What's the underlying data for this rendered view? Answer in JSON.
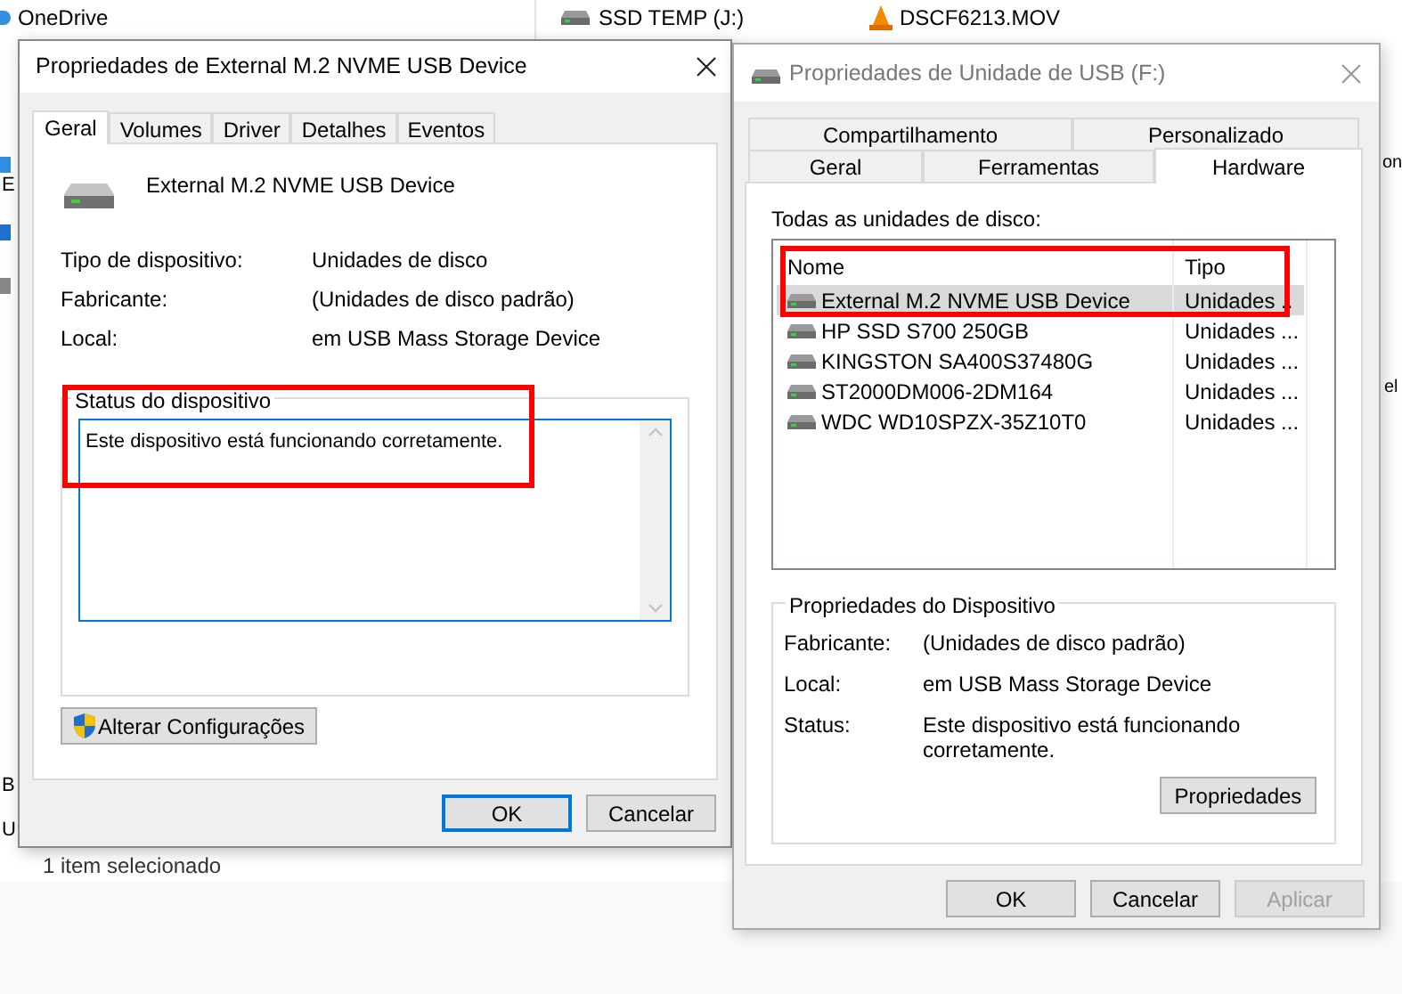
{
  "background": {
    "nav_items": [
      "OneDrive"
    ],
    "drive": "SSD TEMP (J:)",
    "file": "DSCF6213.MOV",
    "status_bar": "1 item selecionado",
    "left_fragments": [
      "E",
      "B",
      "U"
    ],
    "right_fragments": [
      "on",
      "el"
    ]
  },
  "device_dialog": {
    "title": "Propriedades de External M.2 NVME USB Device",
    "tabs": [
      {
        "label": "Geral",
        "selected": true
      },
      {
        "label": "Volumes",
        "selected": false
      },
      {
        "label": "Driver",
        "selected": false
      },
      {
        "label": "Detalhes",
        "selected": false
      },
      {
        "label": "Eventos",
        "selected": false
      }
    ],
    "device_name": "External M.2 NVME USB Device",
    "properties": [
      {
        "label": "Tipo de dispositivo:",
        "value": "Unidades de disco"
      },
      {
        "label": "Fabricante:",
        "value": "(Unidades de disco padrão)"
      },
      {
        "label": "Local:",
        "value": "em USB Mass Storage Device"
      }
    ],
    "status_group": {
      "title": "Status do dispositivo",
      "text": "Este dispositivo está funcionando corretamente."
    },
    "change_button": "Alterar Configurações",
    "buttons": [
      {
        "label": "OK",
        "default": true
      },
      {
        "label": "Cancelar",
        "default": false
      }
    ]
  },
  "drive_dialog": {
    "title": "Propriedades de Unidade de USB (F:)",
    "tab_rows": [
      [
        {
          "label": "Compartilhamento",
          "selected": false
        },
        {
          "label": "Personalizado",
          "selected": false
        }
      ],
      [
        {
          "label": "Geral",
          "selected": false
        },
        {
          "label": "Ferramentas",
          "selected": false
        },
        {
          "label": "Hardware",
          "selected": true
        }
      ]
    ],
    "list_label": "Todas as unidades de disco:",
    "columns": [
      "Nome",
      "Tipo"
    ],
    "disks": [
      {
        "name": "External M.2 NVME USB Device",
        "type": "Unidades ..",
        "selected": true
      },
      {
        "name": "HP SSD S700 250GB",
        "type": "Unidades ...",
        "selected": false
      },
      {
        "name": "KINGSTON SA400S37480G",
        "type": "Unidades ...",
        "selected": false
      },
      {
        "name": "ST2000DM006-2DM164",
        "type": "Unidades ...",
        "selected": false
      },
      {
        "name": "WDC WD10SPZX-35Z10T0",
        "type": "Unidades ...",
        "selected": false
      }
    ],
    "group": {
      "title": "Propriedades do Dispositivo",
      "rows": [
        {
          "label": "Fabricante:",
          "value": "(Unidades de disco padrão)"
        },
        {
          "label": "Local:",
          "value": "em USB Mass Storage Device"
        },
        {
          "label": "Status:",
          "value": "Este dispositivo está funcionando corretamente."
        }
      ],
      "button": "Propriedades"
    },
    "buttons": [
      {
        "label": "OK",
        "disabled": false
      },
      {
        "label": "Cancelar",
        "disabled": false
      },
      {
        "label": "Aplicar",
        "disabled": true
      }
    ]
  }
}
